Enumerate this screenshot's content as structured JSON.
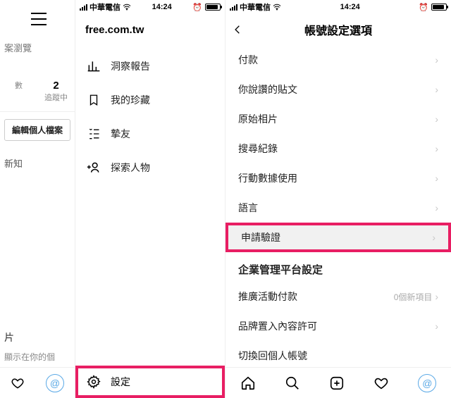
{
  "status": {
    "carrier": "中華電信",
    "time": "14:24"
  },
  "left": {
    "browse": "案瀏覽",
    "stats": [
      {
        "n": "",
        "l": "數"
      },
      {
        "n": "2",
        "l": "追蹤中"
      }
    ],
    "editProfile": "編輯個人檔案",
    "notif": "新知",
    "photoTab": "片",
    "sub": "顯示在你的個"
  },
  "mid": {
    "account": "free.com.tw",
    "items": [
      {
        "icon": "insights-icon",
        "label": "洞察報告"
      },
      {
        "icon": "bookmark-icon",
        "label": "我的珍藏"
      },
      {
        "icon": "closefriends-icon",
        "label": "摯友"
      },
      {
        "icon": "discover-icon",
        "label": "探索人物"
      }
    ],
    "settings": "設定"
  },
  "right": {
    "title": "帳號設定選項",
    "rows": [
      {
        "label": "付款",
        "chev": true
      },
      {
        "label": "你說讚的貼文",
        "chev": true
      },
      {
        "label": "原始相片",
        "chev": true
      },
      {
        "label": "搜尋紀錄",
        "chev": true
      },
      {
        "label": "行動數據使用",
        "chev": true
      },
      {
        "label": "語言",
        "chev": true
      },
      {
        "label": "申請驗證",
        "chev": true,
        "highlight": true
      },
      {
        "label": "企業管理平台設定",
        "section": true
      },
      {
        "label": "推廣活動付款",
        "chev": true,
        "trail": "0個新項目"
      },
      {
        "label": "品牌置入內容許可",
        "chev": true
      },
      {
        "label": "切換回個人帳號",
        "chev": false
      }
    ]
  },
  "colors": {
    "accent": "#E81E63"
  }
}
